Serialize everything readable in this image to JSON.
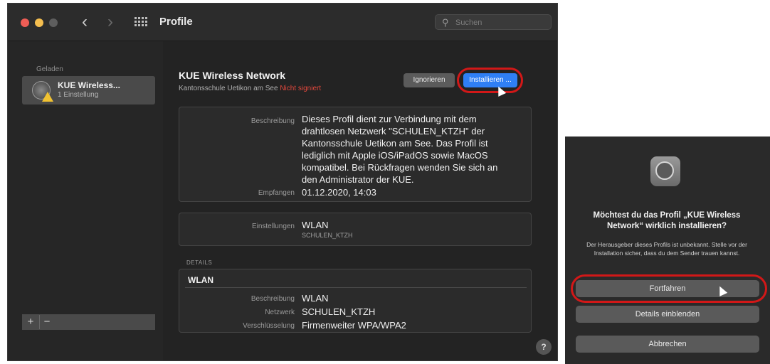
{
  "window": {
    "title": "Profile",
    "search": {
      "placeholder": "Suchen"
    }
  },
  "sidebar": {
    "section_label": "Geladen",
    "items": [
      {
        "name": "KUE Wireless...",
        "subtitle": "1 Einstellung"
      }
    ],
    "add_label": "+",
    "remove_label": "−"
  },
  "profile": {
    "name": "KUE Wireless Network",
    "issuer": "Kantonsschule Uetikon am See",
    "signature_status": "Nicht signiert",
    "ignore_button": "Ignorieren",
    "install_button": "Installieren ...",
    "description_label": "Beschreibung",
    "description_lines": [
      "Dieses Profil dient zur Verbindung mit dem",
      "drahtlosen Netzwerk \"SCHULEN_KTZH\" der",
      "Kantonsschule Uetikon am See. Das Profil ist",
      "lediglich mit Apple iOS/iPadOS sowie MacOS",
      "kompatibel. Bei Rückfragen wenden Sie sich an",
      "den Administrator der KUE."
    ],
    "received_label": "Empfangen",
    "received_value": "01.12.2020, 14:03",
    "settings_label": "Einstellungen",
    "settings_value": "WLAN",
    "settings_sub": "SCHULEN_KTZH",
    "details_heading": "DETAILS",
    "wlan_section": {
      "title": "WLAN",
      "rows": [
        {
          "label": "Beschreibung",
          "value": "WLAN"
        },
        {
          "label": "Netzwerk",
          "value": "SCHULEN_KTZH"
        },
        {
          "label": "Verschlüsselung",
          "value": "Firmenweiter WPA/WPA2"
        }
      ]
    },
    "help_label": "?"
  },
  "dialog": {
    "title": "Möchtest du das Profil „KUE Wireless Network“ wirklich installieren?",
    "body": "Der Herausgeber dieses Profils ist unbekannt. Stelle vor der Installation sicher, dass du dem Sender trauen kannst.",
    "continue_button": "Fortfahren",
    "details_button": "Details einblenden",
    "cancel_button": "Abbrechen"
  },
  "colors": {
    "accent_blue": "#2f7ff5",
    "highlight_red": "#d21818",
    "unsigned_red": "#e0473c",
    "warning_yellow": "#f1c232"
  }
}
